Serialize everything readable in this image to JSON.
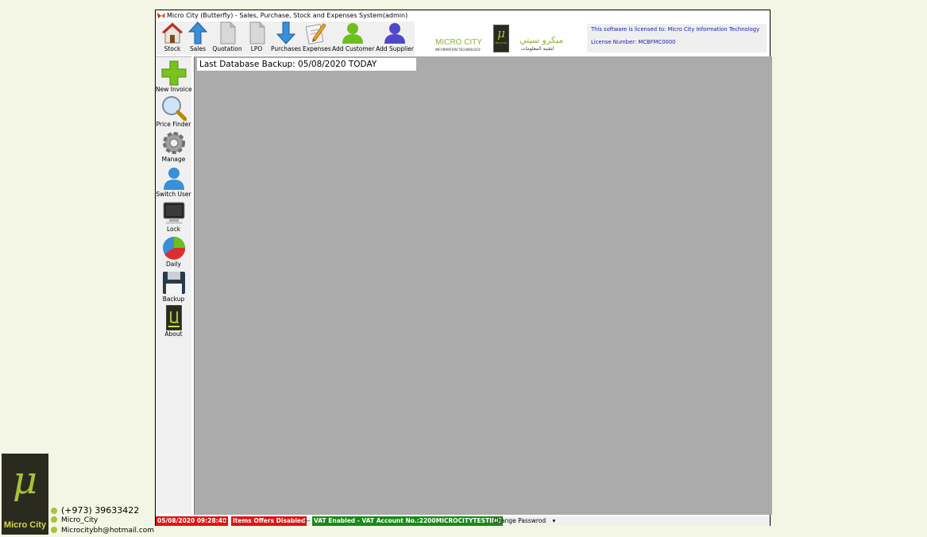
{
  "window": {
    "title": "Micro City (Butterfly) - Sales, Purchase, Stock and Expenses System(admin)"
  },
  "toolbar": {
    "items": [
      {
        "label": "Stock",
        "icon": "house-icon"
      },
      {
        "label": "Sales",
        "icon": "arrow-up-icon"
      },
      {
        "label": "Quotation",
        "icon": "document-icon"
      },
      {
        "label": "LPO",
        "icon": "document-icon"
      },
      {
        "label": "Purchases",
        "icon": "arrow-down-icon"
      },
      {
        "label": "Expenses",
        "icon": "pencil-paper-icon"
      },
      {
        "label": "Add Customer",
        "icon": "person-green-icon"
      },
      {
        "label": "Add Supplier",
        "icon": "person-blue-icon"
      }
    ]
  },
  "logo": {
    "english_name": "MICRO CITY",
    "english_tagline": "INFORMATION TECHNOLOGY",
    "arabic_name": "ميكرو سيتي",
    "arabic_tagline": "لتقنية المعلومات",
    "mu_symbol": "μ",
    "mu_caption": "Micro City"
  },
  "license": {
    "licensed_to": "This software is licensed to: Micro City Information Technology",
    "license_number": "License Number: MCBFMC0000"
  },
  "sidebar": {
    "items": [
      {
        "label": "New Invoice",
        "icon": "plus-icon"
      },
      {
        "label": "Price Finder",
        "icon": "magnifier-icon"
      },
      {
        "label": "Manage",
        "icon": "gear-icon"
      },
      {
        "label": "Switch User",
        "icon": "user-icon"
      },
      {
        "label": "Lock",
        "icon": "monitor-icon"
      },
      {
        "label": "Daily",
        "icon": "pie-chart-icon"
      },
      {
        "label": "Backup",
        "icon": "floppy-disk-icon"
      },
      {
        "label": "About",
        "icon": "mu-logo-icon"
      }
    ]
  },
  "main": {
    "backup_text": "Last Database Backup: 05/08/2020 TODAY"
  },
  "status": {
    "datetime": "05/08/2020 09:28:40",
    "sep1": "---",
    "offers": "Items Offers Disabled",
    "sep2": "---",
    "vat": "VAT Enabled - VAT Account No.:2200MICROCITYTESTING",
    "change_password": "Change Passwrod"
  },
  "corner": {
    "mu": "μ",
    "brand": "Micro City",
    "phone": "(+973) 39633422",
    "instagram": "Micro_City",
    "email": "Microcitybh@hotmail.com"
  },
  "colors": {
    "background": "#f3f6e4",
    "main_area": "#ababab",
    "status_red": "#e01414",
    "status_green": "#178a17",
    "license_text": "#1a1ab0",
    "brand_green": "#a8c23a"
  }
}
